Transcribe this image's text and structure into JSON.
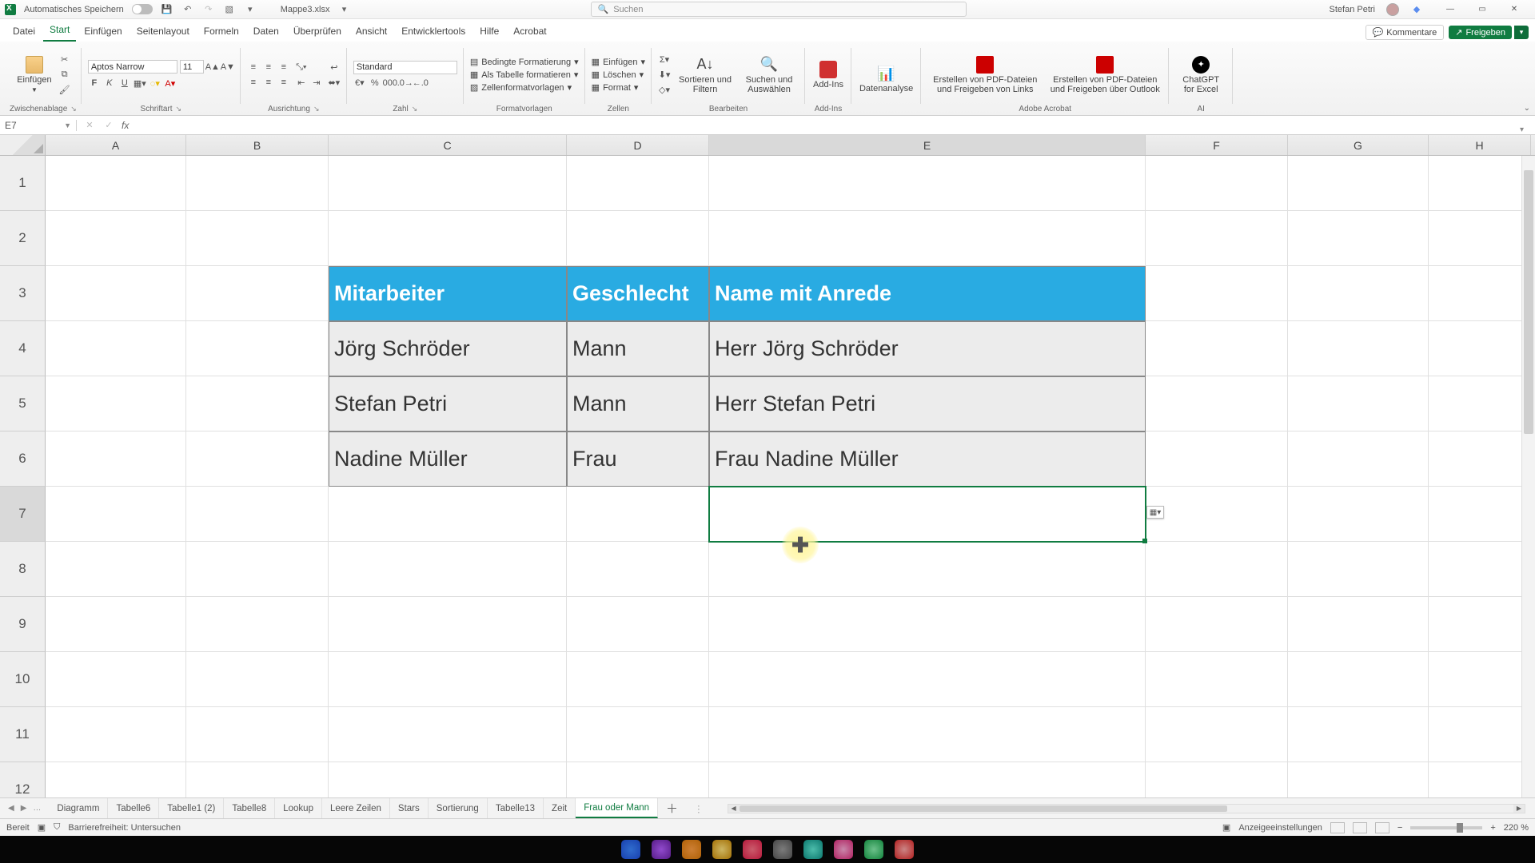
{
  "titlebar": {
    "autosave_label": "Automatisches Speichern",
    "filename": "Mappe3.xlsx",
    "search_placeholder": "Suchen",
    "user_name": "Stefan Petri"
  },
  "menu": {
    "tabs": [
      "Datei",
      "Start",
      "Einfügen",
      "Seitenlayout",
      "Formeln",
      "Daten",
      "Überprüfen",
      "Ansicht",
      "Entwicklertools",
      "Hilfe",
      "Acrobat"
    ],
    "active_index": 1,
    "comments": "Kommentare",
    "share": "Freigeben"
  },
  "ribbon": {
    "clipboard": {
      "paste": "Einfügen",
      "group": "Zwischenablage"
    },
    "font": {
      "name_value": "Aptos Narrow",
      "size_value": "11",
      "group": "Schriftart"
    },
    "alignment": {
      "group": "Ausrichtung"
    },
    "number": {
      "format_value": "Standard",
      "group": "Zahl"
    },
    "styles": {
      "cond": "Bedingte Formatierung",
      "astable": "Als Tabelle formatieren",
      "cellstyles": "Zellenformatvorlagen",
      "group": "Formatvorlagen"
    },
    "cells": {
      "insert": "Einfügen",
      "delete": "Löschen",
      "format": "Format",
      "group": "Zellen"
    },
    "editing": {
      "sort": "Sortieren und Filtern",
      "find": "Suchen und Auswählen",
      "group": "Bearbeiten"
    },
    "addins": {
      "addins": "Add-Ins",
      "group": "Add-Ins"
    },
    "data": {
      "analysis": "Datenanalyse"
    },
    "acrobat": {
      "pdf1": "Erstellen von PDF-Dateien und Freigeben von Links",
      "pdf2": "Erstellen von PDF-Dateien und Freigeben über Outlook",
      "group": "Adobe Acrobat"
    },
    "ai": {
      "gpt": "ChatGPT for Excel",
      "group": "AI"
    }
  },
  "namebox": {
    "value": "E7"
  },
  "columns": [
    "A",
    "B",
    "C",
    "D",
    "E",
    "F",
    "G",
    "H"
  ],
  "row_numbers": [
    "1",
    "2",
    "3",
    "4",
    "5",
    "6",
    "7",
    "8",
    "9",
    "10",
    "11",
    "12"
  ],
  "table": {
    "headers": {
      "c": "Mitarbeiter",
      "d": "Geschlecht",
      "e": "Name mit Anrede"
    },
    "rows": [
      {
        "c": "Jörg Schröder",
        "d": "Mann",
        "e": "Herr Jörg Schröder"
      },
      {
        "c": "Stefan Petri",
        "d": "Mann",
        "e": "Herr Stefan Petri"
      },
      {
        "c": "Nadine Müller",
        "d": "Frau",
        "e": "Frau Nadine Müller"
      }
    ]
  },
  "sheets": {
    "tabs": [
      "Diagramm",
      "Tabelle6",
      "Tabelle1 (2)",
      "Tabelle8",
      "Lookup",
      "Leere Zeilen",
      "Stars",
      "Sortierung",
      "Tabelle13",
      "Zeit",
      "Frau oder Mann"
    ],
    "active_index": 10,
    "more": "…"
  },
  "statusbar": {
    "ready": "Bereit",
    "accessibility": "Barrierefreiheit: Untersuchen",
    "display_settings": "Anzeigeeinstellungen",
    "zoom": "220 %"
  }
}
